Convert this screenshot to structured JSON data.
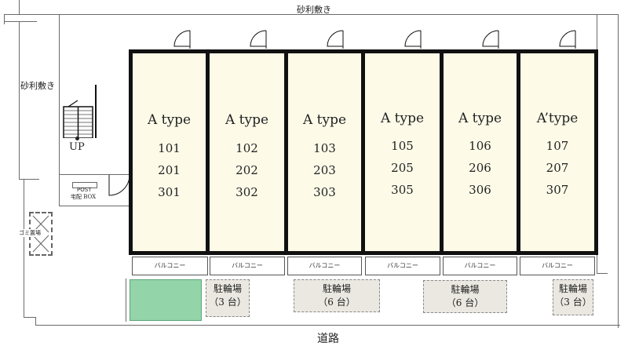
{
  "labels": {
    "gravel_top": "砂利敷き",
    "gravel_left": "砂利敷き",
    "up": "UP",
    "post_line1": "POST",
    "post_line2": "宅配 BOX",
    "trash": "ゴミ置場",
    "road": "道路"
  },
  "units": [
    {
      "type": "A type",
      "rooms": [
        "101",
        "201",
        "301"
      ],
      "balcony": "バルコニー"
    },
    {
      "type": "A type",
      "rooms": [
        "102",
        "202",
        "302"
      ],
      "balcony": "バルコニー"
    },
    {
      "type": "A type",
      "rooms": [
        "103",
        "203",
        "303"
      ],
      "balcony": "バルコニー"
    },
    {
      "type": "A type",
      "rooms": [
        "105",
        "205",
        "305"
      ],
      "balcony": "バルコニー"
    },
    {
      "type": "A type",
      "rooms": [
        "106",
        "206",
        "306"
      ],
      "balcony": "バルコニー"
    },
    {
      "type": "A’type",
      "rooms": [
        "107",
        "207",
        "307"
      ],
      "balcony": "バルコニー"
    }
  ],
  "bike_parking": [
    {
      "name": "駐輪場",
      "capacity": "（3 台）"
    },
    {
      "name": "駐輪場",
      "capacity": "（6 台）"
    },
    {
      "name": "駐輪場",
      "capacity": "（6 台）"
    },
    {
      "name": "駐輪場",
      "capacity": "（3 台）"
    }
  ],
  "colors": {
    "unit_fill": "#fdfbe8",
    "garden_fill": "#93d4a8",
    "bike_fill": "#eae8e1"
  }
}
